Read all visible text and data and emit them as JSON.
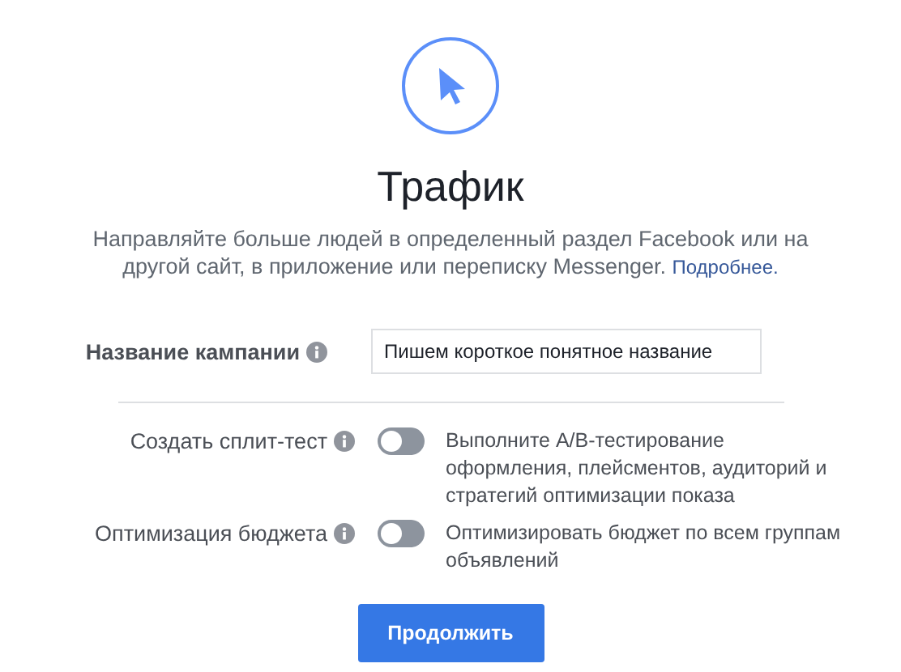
{
  "title": "Трафик",
  "description": "Направляйте больше людей в определенный раздел Facebook или на другой сайт, в приложение или переписку Messenger.",
  "more_link": "Подробнее.",
  "campaign_name": {
    "label": "Название кампании",
    "value": "Пишем короткое понятное название"
  },
  "options": [
    {
      "label": "Создать сплит-тест",
      "on": false,
      "description": "Выполните A/B-тестирование оформления, плейсментов, аудиторий и стратегий оптимизации показа"
    },
    {
      "label": "Оптимизация бюджета",
      "on": false,
      "description": "Оптимизировать бюджет по всем группам объявлений"
    }
  ],
  "button": "Продолжить"
}
